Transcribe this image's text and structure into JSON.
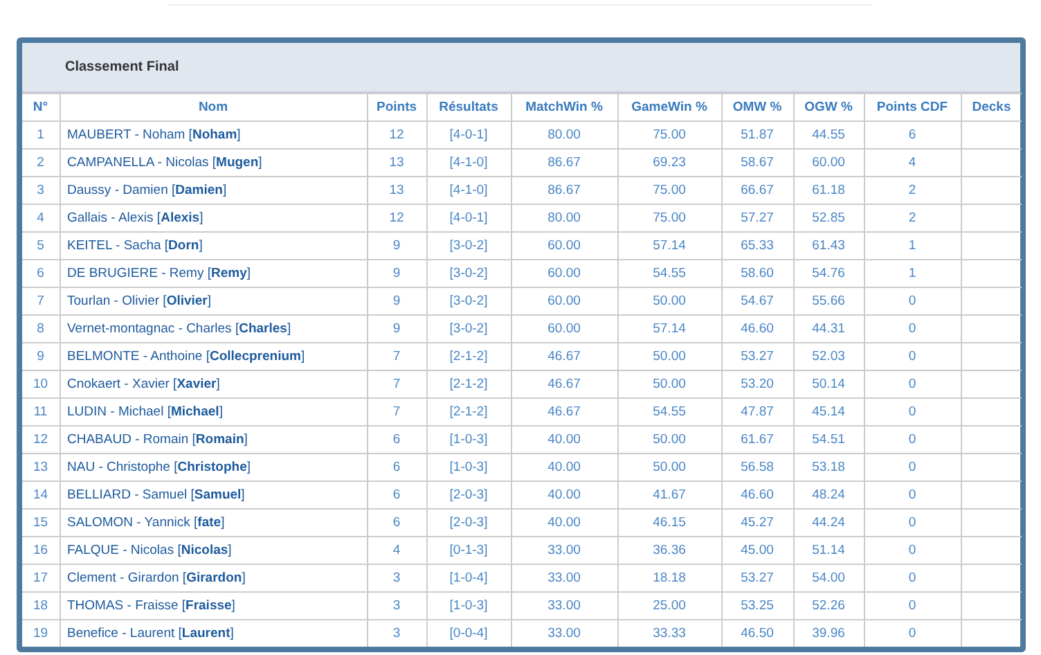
{
  "panel": {
    "title": "Classement Final"
  },
  "table": {
    "columns": [
      "N°",
      "Nom",
      "Points",
      "Résultats",
      "MatchWin %",
      "GameWin %",
      "OMW %",
      "OGW %",
      "Points CDF",
      "Decks"
    ],
    "rows": [
      {
        "rank": "1",
        "name": "MAUBERT - Noham [**Noham**]",
        "points": "12",
        "results": "[4-0-1]",
        "matchwin": "80.00",
        "gamewin": "75.00",
        "omw": "51.87",
        "ogw": "44.55",
        "points_cdf": "6"
      },
      {
        "rank": "2",
        "name": "CAMPANELLA - Nicolas [**Mugen**]",
        "points": "13",
        "results": "[4-1-0]",
        "matchwin": "86.67",
        "gamewin": "69.23",
        "omw": "58.67",
        "ogw": "60.00",
        "points_cdf": "4"
      },
      {
        "rank": "3",
        "name": "Daussy - Damien [**Damien**]",
        "points": "13",
        "results": "[4-1-0]",
        "matchwin": "86.67",
        "gamewin": "75.00",
        "omw": "66.67",
        "ogw": "61.18",
        "points_cdf": "2"
      },
      {
        "rank": "4",
        "name": "Gallais - Alexis [**Alexis**]",
        "points": "12",
        "results": "[4-0-1]",
        "matchwin": "80.00",
        "gamewin": "75.00",
        "omw": "57.27",
        "ogw": "52.85",
        "points_cdf": "2"
      },
      {
        "rank": "5",
        "name": "KEITEL - Sacha [**Dorn**]",
        "points": "9",
        "results": "[3-0-2]",
        "matchwin": "60.00",
        "gamewin": "57.14",
        "omw": "65.33",
        "ogw": "61.43",
        "points_cdf": "1"
      },
      {
        "rank": "6",
        "name": "DE BRUGIERE - Remy [**Remy**]",
        "points": "9",
        "results": "[3-0-2]",
        "matchwin": "60.00",
        "gamewin": "54.55",
        "omw": "58.60",
        "ogw": "54.76",
        "points_cdf": "1"
      },
      {
        "rank": "7",
        "name": "Tourlan - Olivier [**Olivier**]",
        "points": "9",
        "results": "[3-0-2]",
        "matchwin": "60.00",
        "gamewin": "50.00",
        "omw": "54.67",
        "ogw": "55.66",
        "points_cdf": "0"
      },
      {
        "rank": "8",
        "name": "Vernet-montagnac - Charles [**Charles**]",
        "points": "9",
        "results": "[3-0-2]",
        "matchwin": "60.00",
        "gamewin": "57.14",
        "omw": "46.60",
        "ogw": "44.31",
        "points_cdf": "0"
      },
      {
        "rank": "9",
        "name": "BELMONTE - Anthoine [**Collecprenium**]",
        "points": "7",
        "results": "[2-1-2]",
        "matchwin": "46.67",
        "gamewin": "50.00",
        "omw": "53.27",
        "ogw": "52.03",
        "points_cdf": "0"
      },
      {
        "rank": "10",
        "name": "Cnokaert - Xavier [**Xavier**]",
        "points": "7",
        "results": "[2-1-2]",
        "matchwin": "46.67",
        "gamewin": "50.00",
        "omw": "53.20",
        "ogw": "50.14",
        "points_cdf": "0"
      },
      {
        "rank": "11",
        "name": "LUDIN - Michael [**Michael**]",
        "points": "7",
        "results": "[2-1-2]",
        "matchwin": "46.67",
        "gamewin": "54.55",
        "omw": "47.87",
        "ogw": "45.14",
        "points_cdf": "0"
      },
      {
        "rank": "12",
        "name": "CHABAUD - Romain [**Romain**]",
        "points": "6",
        "results": "[1-0-3]",
        "matchwin": "40.00",
        "gamewin": "50.00",
        "omw": "61.67",
        "ogw": "54.51",
        "points_cdf": "0"
      },
      {
        "rank": "13",
        "name": "NAU - Christophe [**Christophe**]",
        "points": "6",
        "results": "[1-0-3]",
        "matchwin": "40.00",
        "gamewin": "50.00",
        "omw": "56.58",
        "ogw": "53.18",
        "points_cdf": "0"
      },
      {
        "rank": "14",
        "name": "BELLIARD - Samuel [**Samuel**]",
        "points": "6",
        "results": "[2-0-3]",
        "matchwin": "40.00",
        "gamewin": "41.67",
        "omw": "46.60",
        "ogw": "48.24",
        "points_cdf": "0"
      },
      {
        "rank": "15",
        "name": "SALOMON - Yannick [**fate**]",
        "points": "6",
        "results": "[2-0-3]",
        "matchwin": "40.00",
        "gamewin": "46.15",
        "omw": "45.27",
        "ogw": "44.24",
        "points_cdf": "0"
      },
      {
        "rank": "16",
        "name": "FALQUE - Nicolas [**Nicolas**]",
        "points": "4",
        "results": "[0-1-3]",
        "matchwin": "33.00",
        "gamewin": "36.36",
        "omw": "45.00",
        "ogw": "51.14",
        "points_cdf": "0"
      },
      {
        "rank": "17",
        "name": "Clement - Girardon [**Girardon**]",
        "points": "3",
        "results": "[1-0-4]",
        "matchwin": "33.00",
        "gamewin": "18.18",
        "omw": "53.27",
        "ogw": "54.00",
        "points_cdf": "0"
      },
      {
        "rank": "18",
        "name": "THOMAS - Fraisse [**Fraisse**]",
        "points": "3",
        "results": "[1-0-3]",
        "matchwin": "33.00",
        "gamewin": "25.00",
        "omw": "53.25",
        "ogw": "52.26",
        "points_cdf": "0"
      },
      {
        "rank": "19",
        "name": "Benefice - Laurent [**Laurent**]",
        "points": "3",
        "results": "[0-0-4]",
        "matchwin": "33.00",
        "gamewin": "33.33",
        "omw": "46.50",
        "ogw": "39.96",
        "points_cdf": "0"
      }
    ]
  }
}
